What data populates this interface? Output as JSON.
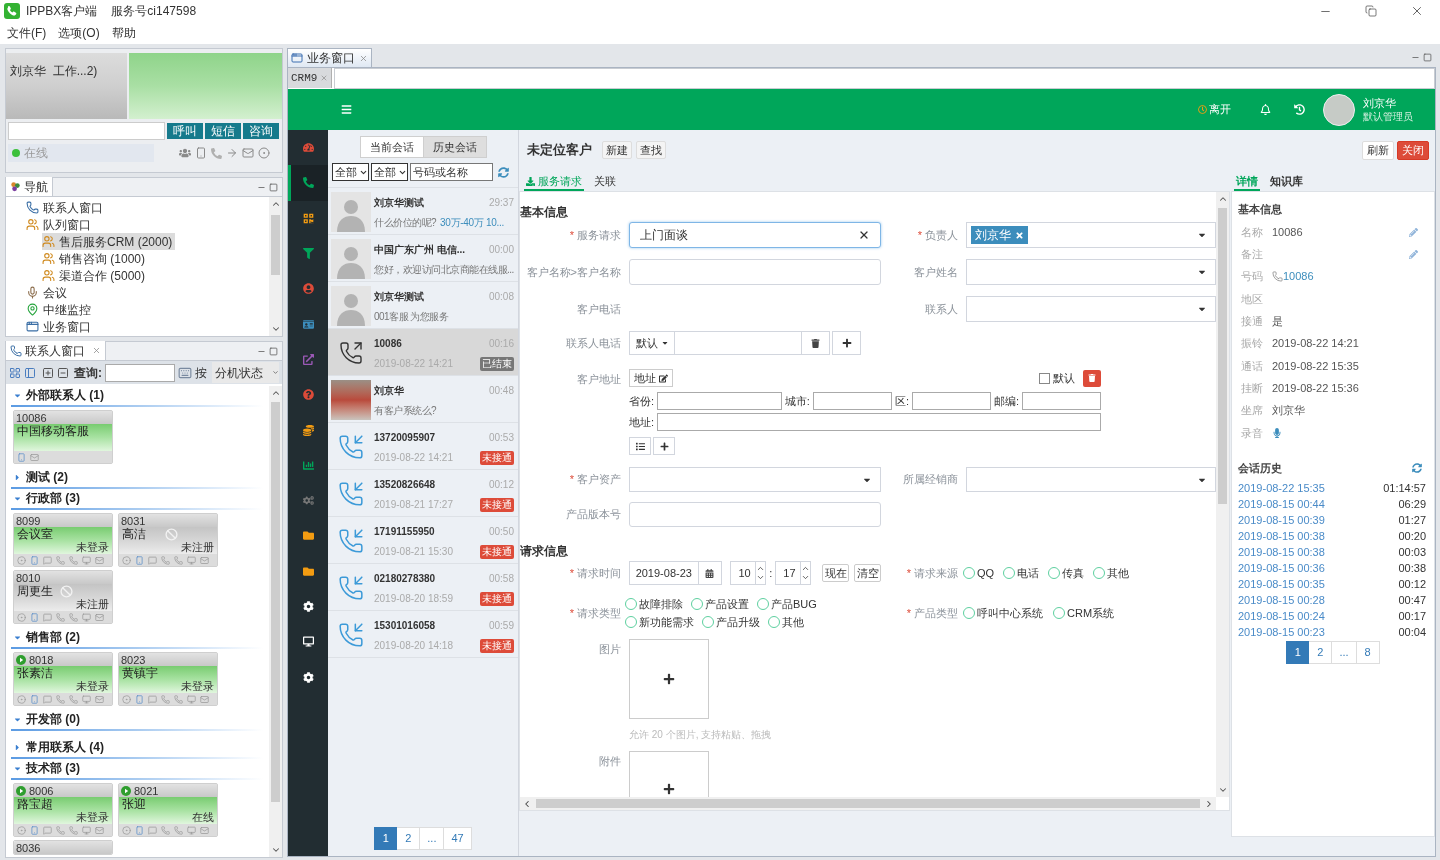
{
  "window": {
    "title": "IPPBX客户端",
    "service": "服务号ci147598"
  },
  "menu": [
    "文件(F)",
    "选项(O)",
    "帮助"
  ],
  "agent": {
    "name_status": "刘京华  工作...2)",
    "actions": [
      "呼叫",
      "短信",
      "咨询"
    ],
    "status": "在线"
  },
  "nav": {
    "tab": "导航",
    "items": [
      {
        "label": "联系人窗口",
        "kind": "contacts",
        "selected": false
      },
      {
        "label": "队列窗口",
        "kind": "queue",
        "selected": false,
        "children": [
          {
            "label": "售后服务CRM (2000)",
            "kind": "queue",
            "selected": true
          },
          {
            "label": "销售咨询 (1000)",
            "kind": "queue",
            "selected": false
          },
          {
            "label": "渠道合作 (5000)",
            "kind": "queue",
            "selected": false
          }
        ]
      },
      {
        "label": "会议",
        "kind": "meeting",
        "selected": false
      },
      {
        "label": "中继监控",
        "kind": "trunk",
        "selected": false
      },
      {
        "label": "业务窗口",
        "kind": "workspace",
        "selected": false
      }
    ]
  },
  "contacts": {
    "tab": "联系人窗口",
    "search_label": "查询:",
    "sort_label": "按",
    "sort_value": "分机状态",
    "groups": [
      {
        "label": "外部联系人 (1)",
        "expanded": true,
        "cards": [
          {
            "kind": "external",
            "number": "10086",
            "name": "中国移动客服",
            "registered": true
          }
        ]
      },
      {
        "label": "测试 (2)",
        "expanded": false
      },
      {
        "label": "行政部 (3)",
        "expanded": true,
        "cards": [
          {
            "kind": "extension",
            "number": "8099",
            "name": "会议室",
            "status": "未登录",
            "registered": true,
            "indicator": false
          },
          {
            "kind": "extension",
            "number": "8031",
            "name": "高洁",
            "status": "未注册",
            "registered": false,
            "indicator": false
          },
          {
            "kind": "extension",
            "number": "8010",
            "name": "周更生",
            "status": "未注册",
            "registered": false,
            "indicator": false
          }
        ]
      },
      {
        "label": "销售部 (2)",
        "expanded": true,
        "cards": [
          {
            "kind": "extension",
            "number": "8018",
            "name": "张素洁",
            "status": "未登录",
            "registered": true,
            "indicator": true
          },
          {
            "kind": "extension",
            "number": "8023",
            "name": "黄镇宇",
            "status": "未登录",
            "registered": true,
            "indicator": false
          }
        ]
      },
      {
        "label": "开发部 (0)",
        "expanded": true
      },
      {
        "label": "常用联系人 (4)",
        "expanded": false
      },
      {
        "label": "技术部 (3)",
        "expanded": true,
        "cards": [
          {
            "kind": "extension",
            "number": "8006",
            "name": "路宝超",
            "status": "未登录",
            "registered": true,
            "indicator": true
          },
          {
            "kind": "extension",
            "number": "8021",
            "name": "张迎",
            "status": "在线",
            "registered": true,
            "indicator": true
          },
          {
            "kind": "partial",
            "number": "8036"
          }
        ]
      }
    ]
  },
  "workspace": {
    "tab": "业务窗口",
    "subtab": "CRM9"
  },
  "crm": {
    "header": {
      "status": "离开",
      "user": "刘京华",
      "role": "默认管理员"
    },
    "sidebar": [
      {
        "selected": false
      },
      {
        "selected": true
      },
      {
        "selected": false
      },
      {
        "selected": false
      },
      {
        "selected": false
      },
      {
        "selected": false
      },
      {
        "selected": false
      },
      {
        "selected": false
      },
      {
        "selected": false
      },
      {
        "selected": false
      },
      {
        "selected": false
      },
      {
        "selected": false
      },
      {
        "selected": false
      },
      {
        "selected": false
      },
      {
        "selected": false
      },
      {
        "selected": false
      }
    ]
  },
  "conversations": {
    "tabs": [
      {
        "label": "当前会话",
        "selected": false
      },
      {
        "label": "历史会话",
        "selected": true
      }
    ],
    "filters": [
      "全部",
      "全部"
    ],
    "search_placeholder": "号码或名称",
    "items": [
      {
        "kind": "chat",
        "title": "刘京华测试",
        "time": "29:37",
        "preview": "什么价位的呢?",
        "preview_link": "30万-40万 10...",
        "selected": false
      },
      {
        "kind": "chat",
        "title": "中国广东广州 电信...",
        "time": "00:00",
        "preview": "您好，欢迎访问北京商能在线服...",
        "selected": false
      },
      {
        "kind": "chat",
        "title": "刘京华测试",
        "time": "00:08",
        "preview": "001客服 为您服务",
        "selected": false
      },
      {
        "kind": "outgoing",
        "title": "10086",
        "time": "00:16",
        "date": "2019-08-22 14:21",
        "badge": {
          "label": "已结束",
          "kind": "ended"
        },
        "selected": true
      },
      {
        "kind": "photo",
        "title": "刘京华",
        "time": "00:48",
        "preview": "有客户系统么?",
        "selected": false
      },
      {
        "kind": "incoming",
        "title": "13720095907",
        "time": "00:53",
        "date": "2019-08-22 14:21",
        "badge": {
          "label": "未接通",
          "kind": "missed"
        },
        "selected": false
      },
      {
        "kind": "incoming",
        "title": "13520826648",
        "time": "00:12",
        "date": "2019-08-21 17:27",
        "badge": {
          "label": "未接通",
          "kind": "missed"
        },
        "selected": false
      },
      {
        "kind": "incoming",
        "title": "17191155950",
        "time": "00:50",
        "date": "2019-08-21 15:30",
        "badge": {
          "label": "未接通",
          "kind": "missed"
        },
        "selected": false
      },
      {
        "kind": "incoming",
        "title": "02180278380",
        "time": "00:58",
        "date": "2019-08-20 18:59",
        "badge": {
          "label": "未接通",
          "kind": "missed"
        },
        "selected": false
      },
      {
        "kind": "incoming",
        "title": "15301016058",
        "time": "00:59",
        "date": "2019-08-20 14:18",
        "badge": {
          "label": "未接通",
          "kind": "missed"
        },
        "selected": false
      }
    ],
    "pages": [
      {
        "label": "1",
        "selected": true
      },
      {
        "label": "2",
        "selected": false
      },
      {
        "label": "...",
        "selected": false
      },
      {
        "label": "47",
        "selected": false
      }
    ]
  },
  "form": {
    "title": "未定位客户",
    "actions": [
      "新建",
      "查找"
    ],
    "side_actions": [
      {
        "label": "刷新",
        "kind": "default"
      },
      {
        "label": "关闭",
        "kind": "danger"
      }
    ],
    "tabs": [
      {
        "label": "服务请求",
        "selected": true
      },
      {
        "label": "关联",
        "selected": false
      }
    ],
    "basic": {
      "title": "基本信息",
      "rows": [
        [
          {
            "mark": "*",
            "label": "服务请求",
            "kind": "input",
            "value": "上门面谈",
            "focused": true
          },
          {
            "mark": "*",
            "label": "负责人",
            "kind": "select",
            "tags": [
              "刘京华"
            ]
          }
        ],
        [
          {
            "label": "客户名称>客户名称",
            "kind": "input",
            "focused": false
          },
          {
            "label": "客户姓名",
            "kind": "select"
          }
        ],
        [
          {
            "label": "客户电话",
            "kind": "none"
          },
          {
            "label": "联系人",
            "kind": "select"
          }
        ]
      ],
      "contact_phone": {
        "label": "联系人电话",
        "type": "默认"
      },
      "address": {
        "label": "客户地址",
        "button": "地址",
        "default_label": "默认",
        "default_checked": false,
        "parts": [
          "省份:",
          "城市:",
          "区:",
          "邮编:"
        ],
        "street": "地址:"
      },
      "rows2": [
        [
          {
            "mark": "*",
            "label": "客户资产",
            "kind": "select"
          },
          {
            "label": "所属经销商",
            "kind": "select"
          }
        ],
        [
          {
            "label": "产品版本号",
            "kind": "input",
            "focused": false
          }
        ]
      ]
    },
    "request": {
      "title": "请求信息",
      "time": {
        "mark": "*",
        "label": "请求时间",
        "date": "2019-08-23",
        "hour": "10",
        "separator": ":",
        "minute": "17",
        "buttons": [
          "现在",
          "清空"
        ]
      },
      "source": {
        "mark": "*",
        "label": "请求来源",
        "options": [
          {
            "label": "QQ",
            "selected": false
          },
          {
            "label": "电话",
            "selected": false
          },
          {
            "label": "传真",
            "selected": false
          },
          {
            "label": "其他",
            "selected": false
          }
        ]
      },
      "type": {
        "mark": "*",
        "label": "请求类型",
        "options": [
          {
            "label": "故障排除",
            "selected": false
          },
          {
            "label": "产品设置",
            "selected": false
          },
          {
            "label": "产品BUG",
            "selected": false
          },
          {
            "label": "新功能需求",
            "selected": false
          },
          {
            "label": "产品升级",
            "selected": false
          },
          {
            "label": "其他",
            "selected": false
          }
        ]
      },
      "product_type": {
        "mark": "*",
        "label": "产品类型",
        "options": [
          {
            "label": "呼叫中心系统",
            "selected": false
          },
          {
            "label": "CRM系统",
            "selected": false
          }
        ]
      },
      "images": {
        "label": "图片",
        "hint": "允许 20 个图片, 支持粘贴、拖拽"
      },
      "attachments": {
        "label": "附件"
      }
    }
  },
  "detail": {
    "tabs": [
      {
        "label": "详情",
        "selected": true
      },
      {
        "label": "知识库",
        "selected": false
      }
    ],
    "title": "基本信息",
    "fields": [
      {
        "label": "名称",
        "kind": "editable",
        "value": "10086"
      },
      {
        "label": "备注",
        "kind": "editable"
      },
      {
        "label": "号码",
        "kind": "phone",
        "value": "10086"
      },
      {
        "label": "地区",
        "kind": "text"
      },
      {
        "label": "接通",
        "kind": "text",
        "value": "是"
      },
      {
        "label": "振铃",
        "kind": "text",
        "value": "2019-08-22 14:21"
      },
      {
        "label": "通话",
        "kind": "text",
        "value": "2019-08-22 15:35"
      },
      {
        "label": "挂断",
        "kind": "text",
        "value": "2019-08-22 15:36"
      },
      {
        "label": "坐席",
        "kind": "text",
        "value": "刘京华"
      },
      {
        "label": "录音",
        "kind": "recording"
      }
    ],
    "history_title": "会话历史",
    "history": [
      {
        "time": "2019-08-22 15:35",
        "duration": "01:14:57"
      },
      {
        "time": "2019-08-15 00:44",
        "duration": "06:29"
      },
      {
        "time": "2019-08-15 00:39",
        "duration": "01:27"
      },
      {
        "time": "2019-08-15 00:38",
        "duration": "00:20"
      },
      {
        "time": "2019-08-15 00:38",
        "duration": "00:03"
      },
      {
        "time": "2019-08-15 00:36",
        "duration": "00:38"
      },
      {
        "time": "2019-08-15 00:35",
        "duration": "00:12"
      },
      {
        "time": "2019-08-15 00:28",
        "duration": "00:47"
      },
      {
        "time": "2019-08-15 00:24",
        "duration": "00:17"
      },
      {
        "time": "2019-08-15 00:23",
        "duration": "00:04"
      }
    ],
    "pages": [
      {
        "label": "1",
        "selected": true
      },
      {
        "label": "2",
        "selected": false
      },
      {
        "label": "...",
        "selected": false
      },
      {
        "label": "8",
        "selected": false
      }
    ]
  }
}
